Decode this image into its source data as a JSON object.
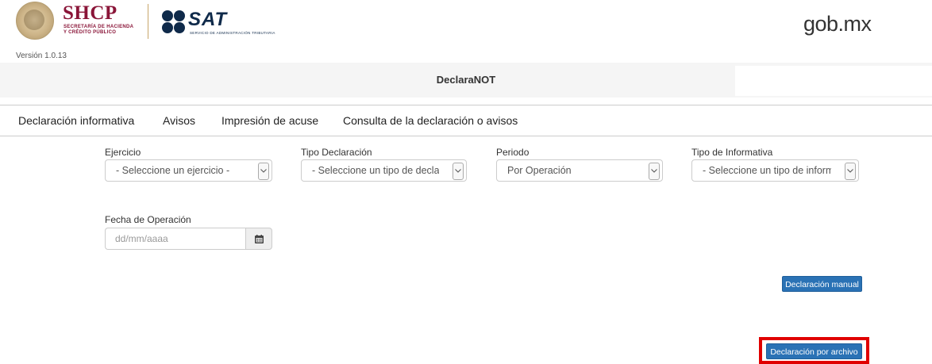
{
  "header": {
    "shcp_title": "SHCP",
    "shcp_sub_line1": "SECRETARÍA DE HACIENDA",
    "shcp_sub_line2": "Y CRÉDITO PÚBLICO",
    "sat_title": "SAT",
    "sat_sub": "SERVICIO DE ADMINISTRACIÓN TRIBUTARIA",
    "gob": "gob.mx",
    "version": "Versión 1.0.13"
  },
  "banner": {
    "title": "DeclaraNOT"
  },
  "nav": {
    "items": [
      {
        "label": "Declaración informativa"
      },
      {
        "label": "Avisos"
      },
      {
        "label": "Impresión de acuse"
      },
      {
        "label": "Consulta de la declaración o avisos"
      }
    ]
  },
  "form": {
    "ejercicio": {
      "label": "Ejercicio",
      "value": "- Seleccione un ejercicio -"
    },
    "tipo_declaracion": {
      "label": "Tipo Declaración",
      "value": "- Seleccione un tipo de declarac"
    },
    "periodo": {
      "label": "Periodo",
      "value": "Por Operación"
    },
    "tipo_informativa": {
      "label": "Tipo de Informativa",
      "value": "- Seleccione un tipo de informa"
    },
    "fecha_operacion": {
      "label": "Fecha de Operación",
      "placeholder": "dd/mm/aaaa"
    }
  },
  "actions": {
    "manual": "Declaración manual",
    "archivo": "Declaración por archivo"
  },
  "colors": {
    "shcp": "#8a1538",
    "sat": "#0f2a4a",
    "button": "#2a72b5",
    "highlight": "#e00000"
  }
}
